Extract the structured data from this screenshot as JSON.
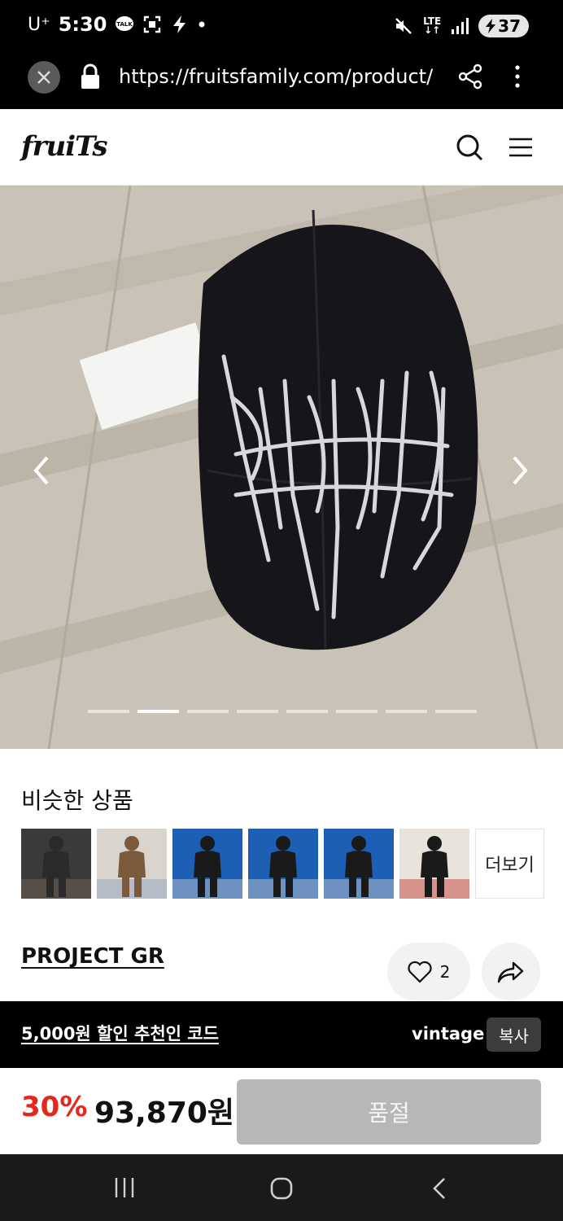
{
  "status_bar": {
    "carrier": "U⁺",
    "time": "5:30",
    "battery": "37",
    "network": "LTE"
  },
  "browser": {
    "url": "https://fruitsfamily.com/product/",
    "close_icon": "close-icon",
    "lock_icon": "lock-icon",
    "share_icon": "share-icon",
    "menu_icon": "more-vert-icon"
  },
  "header": {
    "logo": "fruiTs"
  },
  "gallery": {
    "image_count": 8,
    "active_index": 1
  },
  "similar": {
    "title": "비슷한 상품",
    "more_label": "더보기",
    "thumbs": [
      {
        "bg": "#3a3a3a",
        "figure": "#2a2a2a",
        "accent": "#7a6a5a"
      },
      {
        "bg": "#d9d4cc",
        "figure": "#7a5a3a",
        "accent": "#8aa0c0"
      },
      {
        "bg": "#1d5fb5",
        "figure": "#1a1a1a",
        "accent": "#d0d0d0"
      },
      {
        "bg": "#1d5fb5",
        "figure": "#1a1a1a",
        "accent": "#d0d0d0"
      },
      {
        "bg": "#1d5fb5",
        "figure": "#1a1a1a",
        "accent": "#d0d0d0"
      },
      {
        "bg": "#e8e4dc",
        "figure": "#1a1a1a",
        "accent": "#c0302a"
      }
    ]
  },
  "product": {
    "brand": "PROJECT GR",
    "likes": "2"
  },
  "promo": {
    "text": "5,000원 할인 추천인 코드",
    "code": "vintage",
    "copy_label": "복사"
  },
  "purchase": {
    "discount": "30%",
    "price": "93,870원",
    "button_label": "품절"
  },
  "colors": {
    "discount": "#e5281c",
    "sold_out_button": "#b7b7b7"
  }
}
